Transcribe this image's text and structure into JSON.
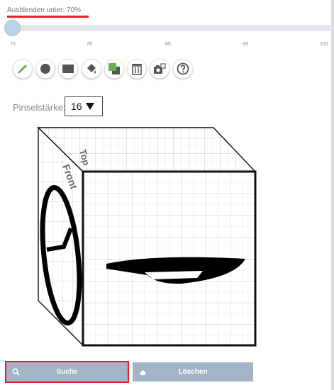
{
  "threshold": {
    "label": "Ausblenden unter: 70%",
    "value_percent": 70,
    "min": 70,
    "max": 100,
    "ticks": [
      "70",
      "78",
      "85",
      "93",
      "100"
    ]
  },
  "toolbar": {
    "tools": [
      {
        "name": "brush-icon",
        "color": "#6ab04c"
      },
      {
        "name": "circle-icon",
        "color": "#555555"
      },
      {
        "name": "rectangle-icon",
        "color": "#555555"
      },
      {
        "name": "fill-bucket-icon",
        "color": "#555555"
      },
      {
        "name": "copy-layer-icon",
        "color": "#6ab04c"
      },
      {
        "name": "trash-icon",
        "color": "#555555"
      },
      {
        "name": "camera-icon",
        "color": "#555555"
      },
      {
        "name": "help-icon",
        "color": "#555555"
      }
    ]
  },
  "brush": {
    "label": "Pinselstärke:",
    "value": "16"
  },
  "cube": {
    "side_label": "Front",
    "top_label": "Top"
  },
  "actions": {
    "search_label": "Suche",
    "clear_label": "Löschen"
  },
  "colors": {
    "accent_red": "#e4202a",
    "button": "#a3b4c6",
    "slider_thumb": "#bcd3e6",
    "icon_green": "#6ab04c"
  }
}
